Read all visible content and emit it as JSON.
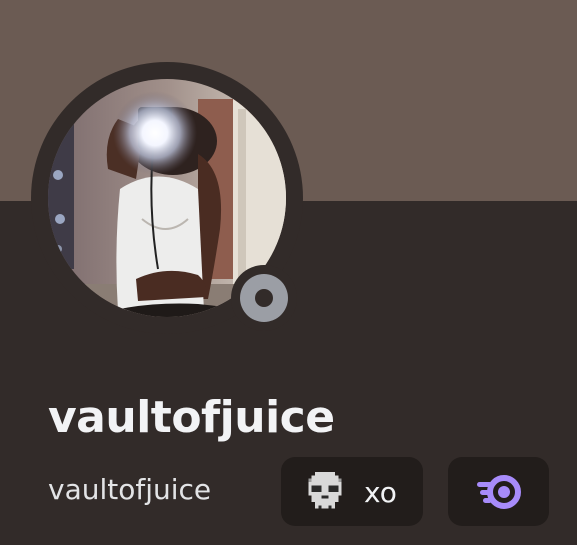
{
  "profile": {
    "display_name": "vaultofjuice",
    "username": "vaultofjuice",
    "status": "offline",
    "avatar_alt": "Profile picture",
    "banner_color": "#6b5b53",
    "background_color": "#322b29"
  },
  "badges": [
    {
      "icon": "skull-icon",
      "label": "xo"
    },
    {
      "icon": "nitro-icon",
      "label": ""
    }
  ],
  "colors": {
    "status_offline": "#9b9ea5",
    "nitro_accent": "#a78bfa",
    "chip_background": "#221d1b"
  }
}
